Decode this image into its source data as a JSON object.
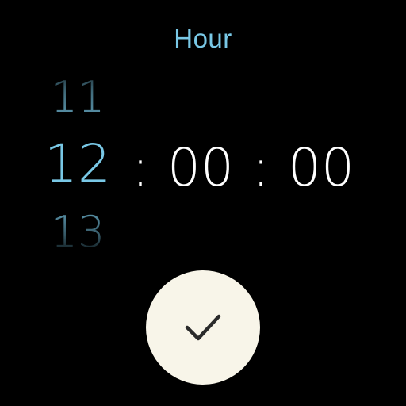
{
  "picker": {
    "title": "Hour",
    "hour_prev": "11",
    "hour_current": "12",
    "hour_next": "13",
    "separator_1": ":",
    "minutes": "00",
    "separator_2": ":",
    "seconds": "00"
  },
  "confirm": {
    "icon": "check-icon"
  },
  "colors": {
    "accent": "#79c8e6",
    "text_primary": "#ffffff",
    "background": "#000000",
    "button_bg": "#f8f5e9",
    "button_icon": "#2b2b2b"
  }
}
